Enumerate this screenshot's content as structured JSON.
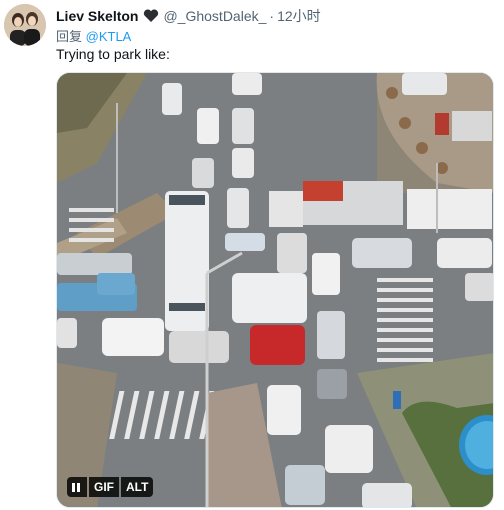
{
  "tweet": {
    "author_name": "Liev Skelton",
    "author_handle": "@_GhostDalek_",
    "separator": "·",
    "time": "12小时",
    "reply_prefix": "回复",
    "reply_to": "@KTLA",
    "text": "Trying to park like:"
  },
  "media": {
    "pause_icon": "pause-icon",
    "gif_label": "GIF",
    "alt_label": "ALT"
  },
  "colors": {
    "link": "#1d9bf0",
    "secondary_text": "#536471",
    "heart": "#2b2f33"
  }
}
